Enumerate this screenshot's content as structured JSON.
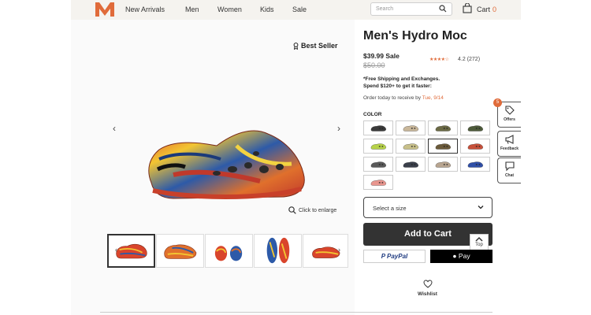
{
  "header": {
    "logo_letter": "M",
    "nav": [
      "New Arrivals",
      "Men",
      "Women",
      "Kids",
      "Sale"
    ],
    "search_placeholder": "Search",
    "cart_label": "Cart",
    "cart_count": "0",
    "brand_color": "#e06b3a"
  },
  "gallery": {
    "badge": "Best Seller",
    "zoom_label": "Click to enlarge",
    "thumb_count": 5,
    "selected_thumb": 0
  },
  "product": {
    "title": "Men's Hydro Moc",
    "sale_price": "$39.99 Sale",
    "original_price": "$50.00",
    "rating_value": "4.2",
    "rating_count": "(272)",
    "stars_filled": 4.2,
    "shipping_line1": "*Free Shipping and Exchanges.",
    "shipping_line2": "Spend $120+ to get it faster:",
    "order_text": "Order today to receive by",
    "order_date": "Tue, 9/14",
    "color_label": "COLOR",
    "swatch_colors": [
      "#3a3a3a",
      "#c9b79a",
      "#6b6a45",
      "#4d5a3a",
      "#b7d34a",
      "#c8c08a",
      "#6b5a3a",
      "#c7503a",
      "#5a5a5a",
      "#3a3f4a",
      "#b8a590",
      "#2f4fa8",
      "#e9968f"
    ],
    "selected_swatch": 6,
    "size_placeholder": "Select a size",
    "add_to_cart": "Add to Cart",
    "paypal_label": "PayPal",
    "applepay_label": "Pay",
    "wishlist_label": "Wishlist",
    "top_label": "Top"
  },
  "side_tabs": {
    "offers_label": "Offers",
    "offers_badge": "5",
    "feedback_label": "Feedback",
    "chat_label": "Chat"
  }
}
